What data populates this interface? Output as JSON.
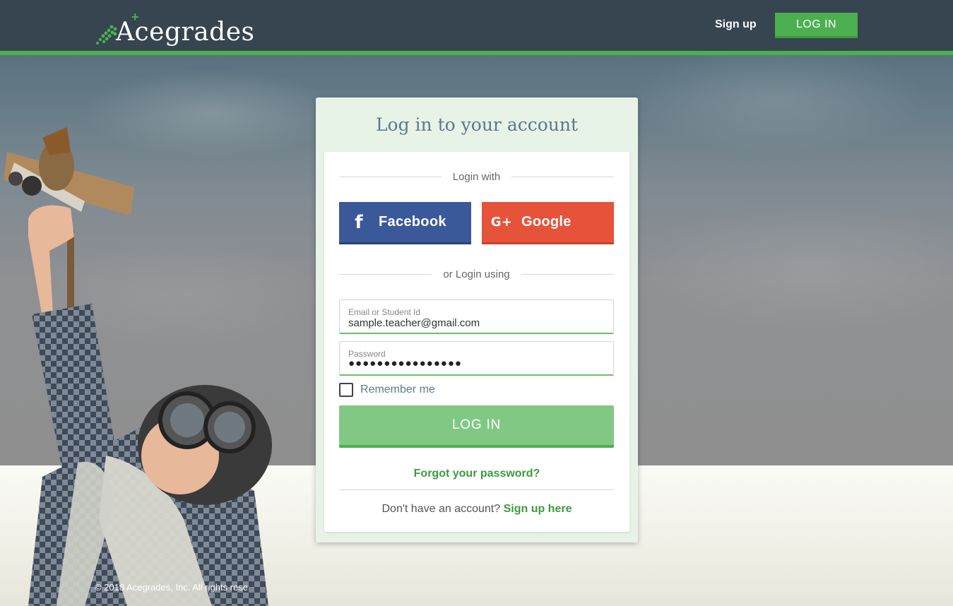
{
  "header": {
    "brand": "Acegrades",
    "brand_plus": "+",
    "signup_label": "Sign up",
    "login_label": "LOG IN"
  },
  "card": {
    "title": "Log in to your account",
    "login_with": "Login with",
    "facebook_label": "Facebook",
    "google_label": "Google",
    "or_login_using": "or Login using",
    "email_label": "Email or Student Id",
    "email_value": "sample.teacher@gmail.com",
    "password_label": "Password",
    "password_value": "●●●●●●●●●●●●●●●●",
    "remember_label": "Remember me",
    "remember_checked": false,
    "login_button": "LOG IN",
    "forgot_label": "Forgot your password?",
    "no_account_text": "Don't have an account?",
    "signup_here": "Sign up here"
  },
  "footer": {
    "copyright": "© 2018 Acegrades, Inc. All rights rese"
  },
  "colors": {
    "header_bg": "#36454f",
    "accent_green": "#4caf50",
    "facebook": "#3b5998",
    "google": "#e5533a",
    "title_text": "#5b7a8c"
  },
  "icons": {
    "brand_mark": "dotted-arrow-logo-icon",
    "facebook": "facebook-f-icon",
    "google": "google-plus-icon"
  }
}
